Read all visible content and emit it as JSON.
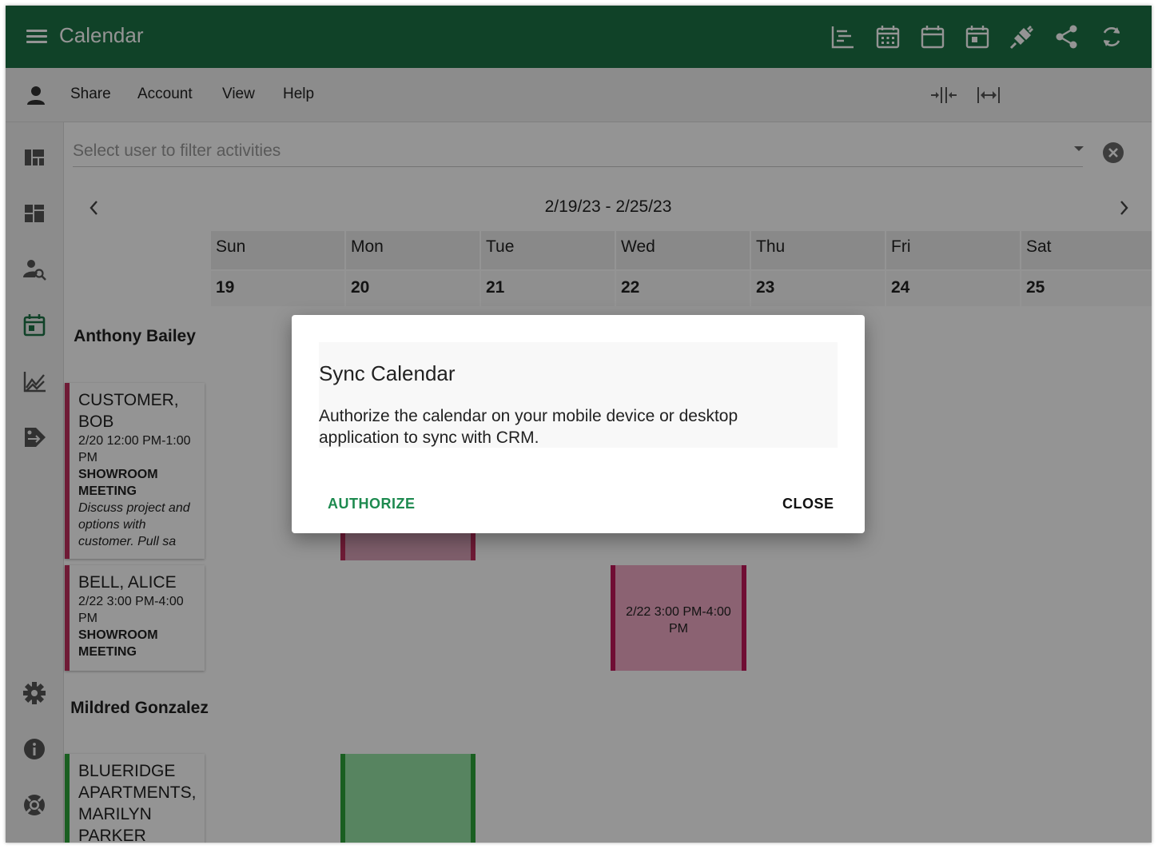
{
  "app": {
    "title": "Calendar",
    "brand_color": "#1d7346",
    "appbar_icons": [
      "gantt-icon",
      "month-calendar-icon",
      "week-calendar-icon",
      "day-calendar-icon",
      "plug-icon",
      "share-icon",
      "sync-icon"
    ]
  },
  "toolbar": {
    "menus": [
      "Share",
      "Account",
      "View",
      "Help"
    ],
    "icons": [
      "collapse-columns-icon",
      "expand-columns-icon"
    ]
  },
  "sidebar": {
    "icons": [
      "dashboard-icon",
      "panels-icon",
      "user-search-icon",
      "calendar-icon",
      "chart-icon",
      "tag-transfer-icon",
      "settings-icon",
      "info-icon",
      "help-ring-icon"
    ],
    "active": "calendar-icon"
  },
  "filter": {
    "placeholder": "Select user to filter activities",
    "value": ""
  },
  "week": {
    "range": "2/19/23 - 2/25/23",
    "days": [
      {
        "name": "Sun",
        "num": "19"
      },
      {
        "name": "Mon",
        "num": "20"
      },
      {
        "name": "Tue",
        "num": "21"
      },
      {
        "name": "Wed",
        "num": "22"
      },
      {
        "name": "Thu",
        "num": "23"
      },
      {
        "name": "Fri",
        "num": "24"
      },
      {
        "name": "Sat",
        "num": "25"
      }
    ]
  },
  "people": [
    {
      "name": "Anthony Bailey",
      "activities": [
        {
          "title": "CUSTOMER, BOB",
          "time": "2/20 12:00 PM-1:00 PM",
          "type": "SHOWROOM MEETING",
          "description": "Discuss project and options with customer. Pull sa",
          "color": "#c0305e"
        },
        {
          "title": "BELL, ALICE",
          "time": "2/22 3:00 PM-4:00 PM",
          "type": "SHOWROOM MEETING",
          "description": "",
          "color": "#c0305e"
        }
      ]
    },
    {
      "name": "Mildred Gonzalez",
      "activities": [
        {
          "title": "BLUERIDGE APARTMENTS, MARILYN PARKER",
          "time": "",
          "type": "",
          "description": "",
          "color": "#2ea43a"
        }
      ]
    }
  ],
  "events": [
    {
      "text": "",
      "color": "#d9a2b8",
      "edge": "#c0305e"
    },
    {
      "text": "2/22 3:00 PM-4:00 PM",
      "color": "#f0a9c5",
      "edge": "#c2185b"
    },
    {
      "text": "",
      "color": "#97e3a5",
      "edge": "#2ea43a"
    }
  ],
  "dialog": {
    "title": "Sync Calendar",
    "message": "Authorize the calendar on your mobile device or desktop application to sync with CRM.",
    "authorize_label": "AUTHORIZE",
    "close_label": "CLOSE",
    "accent_color": "#1d8a4f"
  }
}
